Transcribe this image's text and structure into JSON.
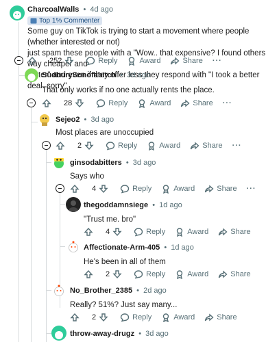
{
  "comments": [
    {
      "author": "CharcoalWalls",
      "time": "4d ago",
      "flair": "Top 1% Commenter",
      "body_lines": [
        "Some guy on TikTok is trying to start a movement where people (whether interested or not)",
        "just spam these people with a \"Wow.. that expensive? I found others way cheaper and",
        "better\" and even if they offer less they respond with \"I took a better deal. sorry\""
      ],
      "votes": "252",
      "avatar_color": "#2ecc9a"
    },
    {
      "author": "SudburySonofabitch",
      "time": "3d ago",
      "body_lines": [
        "That only works if no one actually rents the place."
      ],
      "votes": "28",
      "avatar_color": "#7ed957"
    },
    {
      "author": "Sejeo2",
      "time": "3d ago",
      "body_lines": [
        "Most places are unoccupied"
      ],
      "votes": "2",
      "avatar_color": "#f2c94c"
    },
    {
      "author": "ginsodabitters",
      "time": "3d ago",
      "body_lines": [
        "Says who"
      ],
      "votes": "4",
      "avatar_color": "#46d160"
    },
    {
      "author": "thegoddamnsiege",
      "time": "1d ago",
      "body_lines": [
        "\"Trust me. bro\""
      ],
      "votes": "4",
      "avatar_color": "#222222"
    },
    {
      "author": "Affectionate-Arm-405",
      "time": "1d ago",
      "body_lines": [
        "He's been in all of them"
      ],
      "votes": "2",
      "avatar_color": "#e8e8e8"
    },
    {
      "author": "No_Brother_2385",
      "time": "2d ago",
      "body_lines": [
        "Really? 51%? Just say many..."
      ],
      "votes": "2",
      "avatar_color": "#e8e8e8"
    },
    {
      "author": "throw-away-drugz",
      "time": "3d ago",
      "body_lines": [],
      "avatar_color": "#2ecc9a"
    }
  ],
  "labels": {
    "reply": "Reply",
    "award": "Award",
    "share": "Share",
    "more": "···",
    "dot": "•"
  },
  "colors": {
    "meta": "#576f76",
    "thread_line": "#d6dadc",
    "flair_bg": "#dbe4f0"
  }
}
